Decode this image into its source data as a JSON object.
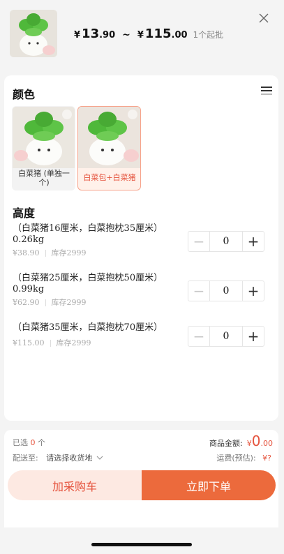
{
  "header": {
    "price_currency_1": "¥",
    "price_int_1": "13",
    "price_dec_1": ".90",
    "tilde": "~",
    "price_currency_2": "¥",
    "price_int_2": "115",
    "price_dec_2": ".00",
    "moq": "1个起批"
  },
  "color_section": {
    "title": "颜色",
    "options": [
      {
        "label": "白菜猪 (单独一个)",
        "selected": false
      },
      {
        "label": "白菜包+白菜猪",
        "selected": true
      }
    ]
  },
  "height_section": {
    "title": "高度",
    "rows": [
      {
        "name": "（白菜猪16厘米，白菜抱枕35厘米）0.26kg",
        "price": "¥38.90",
        "stock": "库存2999",
        "qty": "0"
      },
      {
        "name": "（白菜猪25厘米，白菜抱枕50厘米）0.99kg",
        "price": "¥62.90",
        "stock": "库存2999",
        "qty": "0"
      },
      {
        "name": "（白菜猪35厘米，白菜抱枕70厘米）",
        "price": "¥115.00",
        "stock": "库存2999",
        "qty": "0"
      }
    ]
  },
  "summary": {
    "selected_prefix": "已选",
    "selected_count": "0",
    "selected_suffix": "个",
    "amount_label": "商品金额:",
    "amount_currency": "¥",
    "amount_int": "0",
    "amount_dec": ".00",
    "ship_label": "配送至:",
    "ship_value": "请选择收货地",
    "freight_label": "运费(预估):",
    "freight_value": "¥?"
  },
  "buttons": {
    "cart": "加采购车",
    "buy": "立即下单"
  },
  "colors": {
    "accent": "#ec6a3c",
    "accent_light": "#fde9e2",
    "price_red": "#e5533d"
  }
}
